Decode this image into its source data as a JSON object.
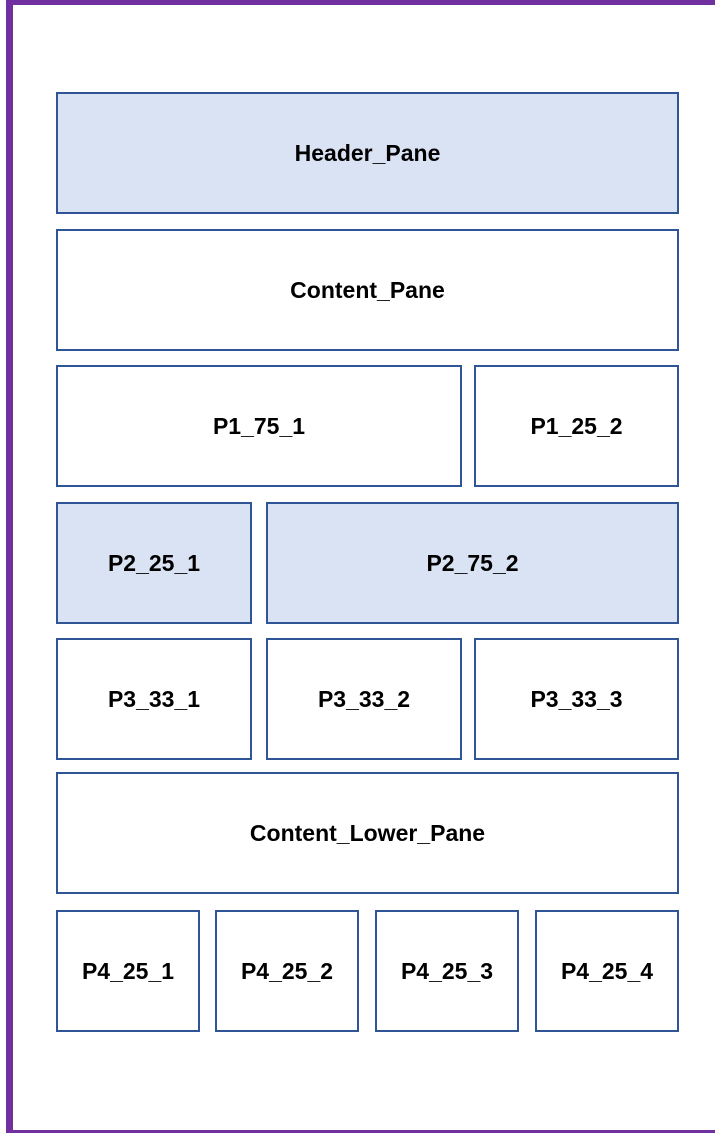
{
  "panes": {
    "header": "Header_Pane",
    "content": "Content_Pane",
    "p1_75_1": "P1_75_1",
    "p1_25_2": "P1_25_2",
    "p2_25_1": "P2_25_1",
    "p2_75_2": "P2_75_2",
    "p3_33_1": "P3_33_1",
    "p3_33_2": "P3_33_2",
    "p3_33_3": "P3_33_3",
    "content_lower": "Content_Lower_Pane",
    "p4_25_1": "P4_25_1",
    "p4_25_2": "P4_25_2",
    "p4_25_3": "P4_25_3",
    "p4_25_4": "P4_25_4"
  },
  "colors": {
    "frame": "#7030a0",
    "pane_border": "#2f5597",
    "shaded_fill": "#dae3f3"
  }
}
